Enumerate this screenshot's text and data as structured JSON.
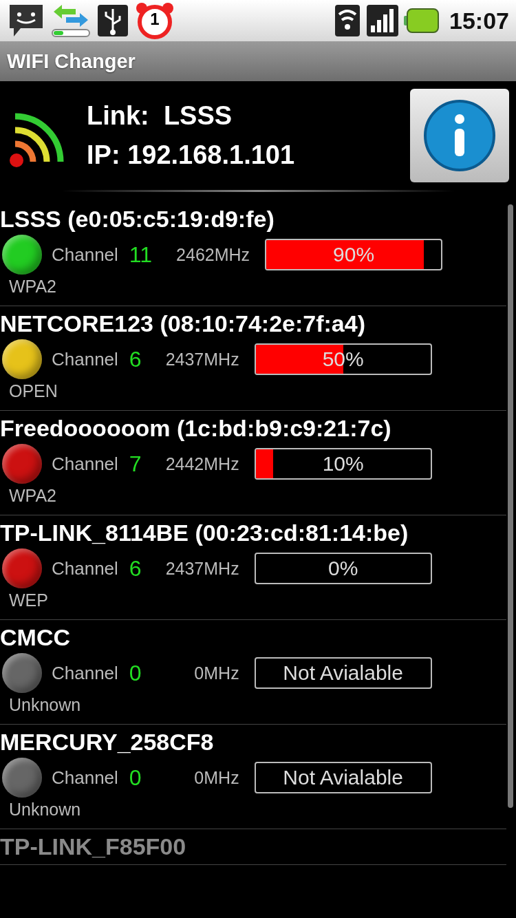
{
  "status_bar": {
    "alarm_badge": "1",
    "time": "15:07"
  },
  "window": {
    "title": "WIFI Changer"
  },
  "connection": {
    "link_label": "Link:",
    "link_value": "LSSS",
    "ip_label": "IP:",
    "ip_value": "192.168.1.101"
  },
  "networks": [
    {
      "name": "LSSS",
      "mac": "(e0:05:c5:19:d9:fe)",
      "color": "#22cc22",
      "channel_label": "Channel",
      "channel": "11",
      "frequency": "2462MHz",
      "kind": "signal",
      "level": 0.9,
      "reading": "90%",
      "security": "WPA2"
    },
    {
      "name": "NETCORE123",
      "mac": "(08:10:74:2e:7f:a4)",
      "color": "#e6c21a",
      "channel_label": "Channel",
      "channel": "6",
      "frequency": "2437MHz",
      "kind": "signal",
      "level": 0.5,
      "reading": "50%",
      "security": "OPEN"
    },
    {
      "name": "Freedoooooom",
      "mac": "(1c:bd:b9:c9:21:7c)",
      "color": "#cc1111",
      "channel_label": "Channel",
      "channel": "7",
      "frequency": "2442MHz",
      "kind": "signal",
      "level": 0.1,
      "reading": "10%",
      "security": "WPA2"
    },
    {
      "name": "TP-LINK_8114BE",
      "mac": "(00:23:cd:81:14:be)",
      "color": "#cc1111",
      "channel_label": "Channel",
      "channel": "6",
      "frequency": "2437MHz",
      "kind": "signal",
      "level": 0,
      "reading": "0%",
      "security": "WEP"
    },
    {
      "name": "CMCC",
      "color": "#666666",
      "channel_label": "Channel",
      "channel": "0",
      "frequency": "0MHz",
      "kind": "unavailable",
      "reading": "Not Avialable",
      "security": "Unknown"
    },
    {
      "name": "MERCURY_258CF8",
      "color": "#666666",
      "channel_label": "Channel",
      "channel": "0",
      "frequency": "0MHz",
      "kind": "unavailable",
      "reading": "Not Avialable",
      "security": "Unknown"
    },
    {
      "name": "TP-LINK_F85F00",
      "kind": "partial"
    }
  ]
}
